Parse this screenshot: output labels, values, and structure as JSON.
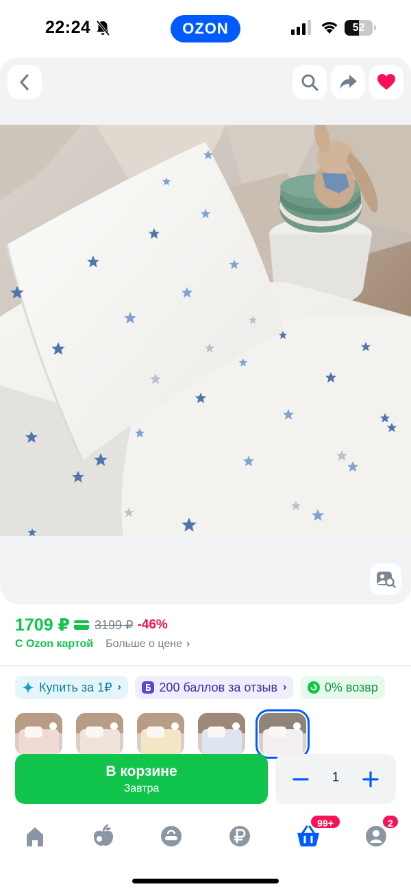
{
  "status_bar": {
    "time": "22:24",
    "battery_level": "52",
    "battery_fraction": 0.52,
    "icons": [
      "bell-slash-icon",
      "cellular-signal-icon",
      "wifi-icon",
      "battery-icon"
    ]
  },
  "header": {
    "logo_text": "OZON",
    "brand_color": "#005bff",
    "icons": [
      "back-chevron-icon",
      "search-icon",
      "share-icon",
      "heart-icon"
    ],
    "favorite_color": "#f91155"
  },
  "gallery": {
    "lens_icon": "image-search-icon"
  },
  "price": {
    "current": "1709 ₽",
    "old": "3199 ₽",
    "discount": "-46%",
    "card_label": "С Ozon картой",
    "more_label": "Больше о цене",
    "accent_color": "#10c44c",
    "discount_color": "#f91155"
  },
  "chips": [
    {
      "label": "Купить за 1₽",
      "icon": "sparkle-icon"
    },
    {
      "label": "200 баллов за отзыв",
      "icon": "points-b-icon"
    },
    {
      "label": "0% возвр",
      "icon": "return-icon"
    }
  ],
  "variants": {
    "count": 5,
    "selected_index": 4
  },
  "cart": {
    "button_label": "В корзине",
    "delivery_label": "Завтра",
    "quantity": "1"
  },
  "tabbar": {
    "tabs": [
      "home-icon",
      "fresh-apple-icon",
      "bag-icon",
      "ruble-icon",
      "cart-icon",
      "profile-icon"
    ],
    "cart_badge": "99+",
    "profile_badge": "2",
    "active_tab": "cart"
  }
}
